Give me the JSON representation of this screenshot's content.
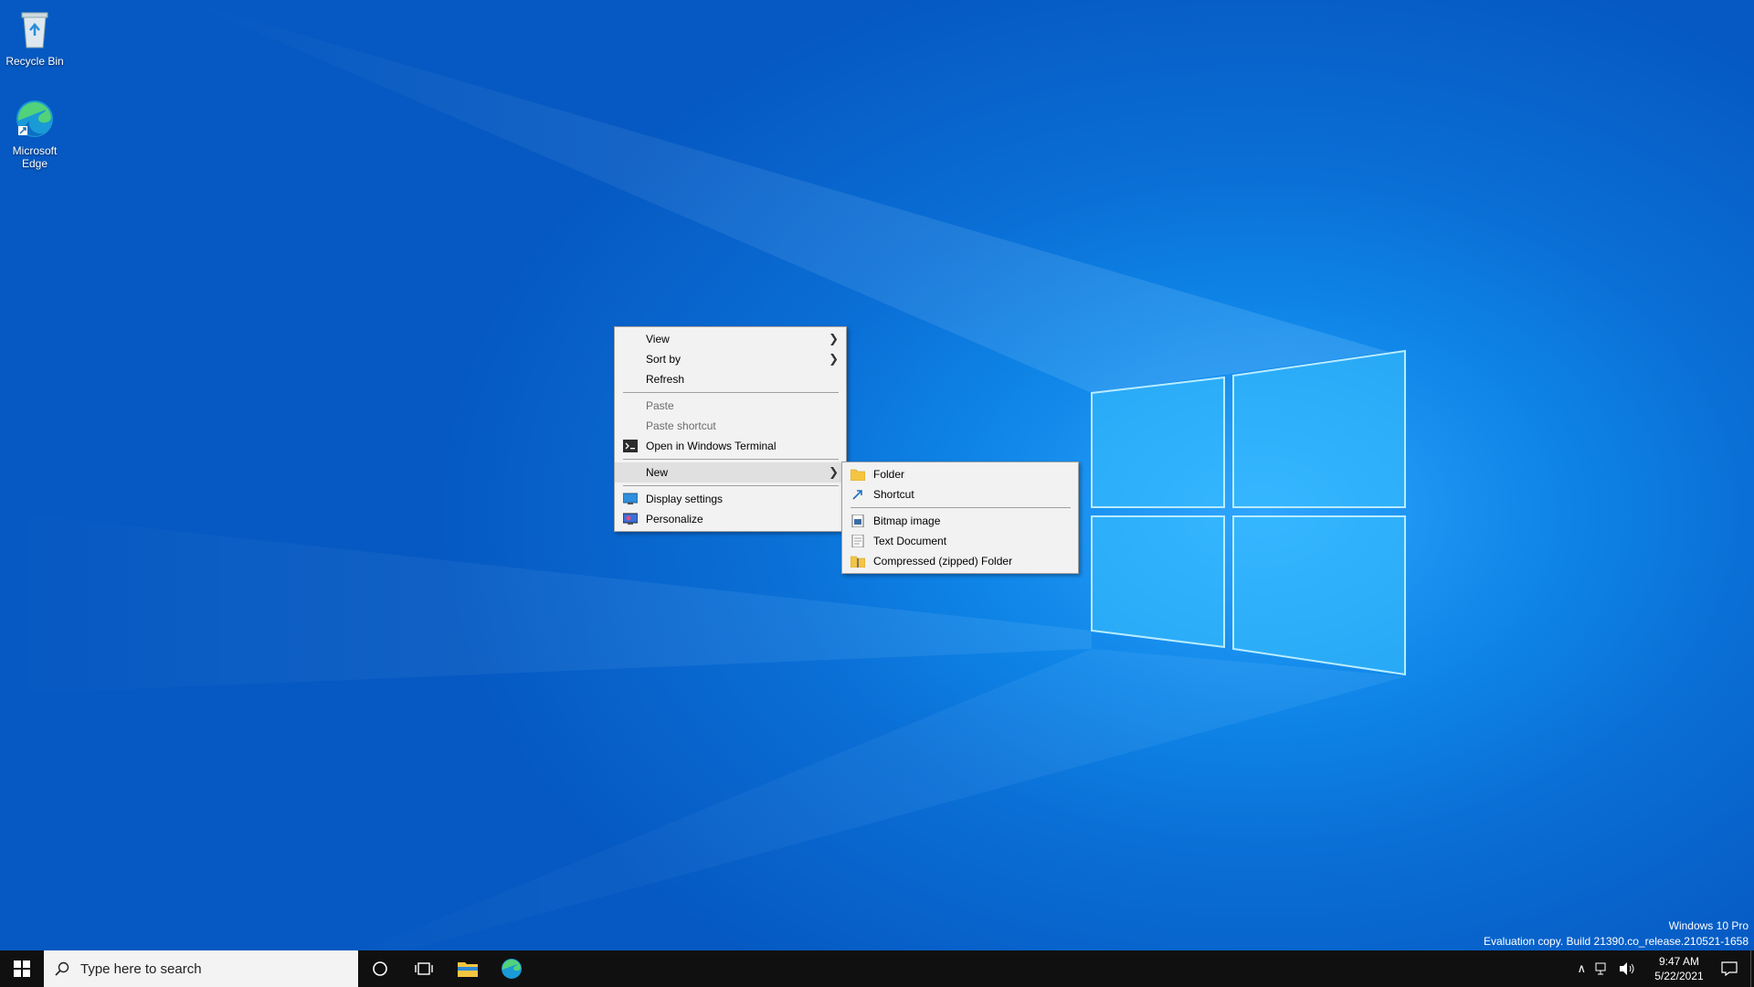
{
  "desktop": {
    "icons": [
      {
        "label": "Recycle Bin",
        "icon": "recycle-bin-icon"
      },
      {
        "label": "Microsoft Edge",
        "icon": "edge-icon"
      }
    ]
  },
  "context_menu": {
    "items": [
      {
        "label": "View",
        "submenu": true
      },
      {
        "label": "Sort by",
        "submenu": true
      },
      {
        "label": "Refresh"
      },
      {
        "label": "Paste",
        "disabled": true
      },
      {
        "label": "Paste shortcut",
        "disabled": true
      },
      {
        "label": "Open in Windows Terminal",
        "icon": "terminal-icon"
      },
      {
        "label": "New",
        "submenu": true
      },
      {
        "label": "Display settings",
        "icon": "display-icon"
      },
      {
        "label": "Personalize",
        "icon": "personalize-icon"
      }
    ]
  },
  "new_submenu": {
    "items": [
      {
        "label": "Folder",
        "icon": "folder-icon"
      },
      {
        "label": "Shortcut",
        "icon": "shortcut-icon"
      },
      {
        "label": "Bitmap image",
        "icon": "bitmap-icon"
      },
      {
        "label": "Text Document",
        "icon": "text-document-icon"
      },
      {
        "label": "Compressed (zipped) Folder",
        "icon": "zip-folder-icon"
      }
    ]
  },
  "watermark": {
    "edition": "Windows 10 Pro",
    "build": "Evaluation copy. Build 21390.co_release.210521-1658"
  },
  "taskbar": {
    "search_placeholder": "Type here to search",
    "clock_time": "9:47 AM",
    "clock_date": "5/22/2021"
  },
  "colors": {
    "taskbar": "#101010",
    "menu_bg": "#f2f2f2",
    "desktop_accent": "#0a6fd6"
  }
}
